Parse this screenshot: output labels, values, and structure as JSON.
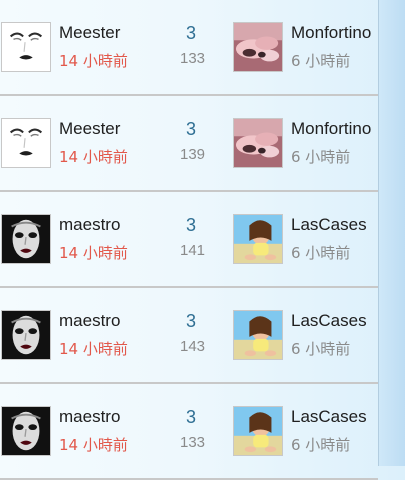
{
  "colors": {
    "background": "#eef8fd",
    "accent": "#2f6f93",
    "time_highlight": "#e2584b",
    "muted": "#8a8a8a",
    "divider": "#c8c8c8"
  },
  "rows": [
    {
      "left_user": "Meester",
      "left_time": "14 小時前",
      "score": "3",
      "sub_score": "133",
      "right_user": "Monfortino",
      "right_time": "6 小時前",
      "left_avatar": "mask-portrait-icon",
      "right_avatar": "pink-photo-icon"
    },
    {
      "left_user": "Meester",
      "left_time": "14 小時前",
      "score": "3",
      "sub_score": "139",
      "right_user": "Monfortino",
      "right_time": "6 小時前",
      "left_avatar": "mask-portrait-icon",
      "right_avatar": "pink-photo-icon"
    },
    {
      "left_user": "maestro",
      "left_time": "14 小時前",
      "score": "3",
      "sub_score": "141",
      "right_user": "LasCases",
      "right_time": "6 小時前",
      "left_avatar": "bw-portrait-icon",
      "right_avatar": "beach-photo-icon"
    },
    {
      "left_user": "maestro",
      "left_time": "14 小時前",
      "score": "3",
      "sub_score": "143",
      "right_user": "LasCases",
      "right_time": "6 小時前",
      "left_avatar": "bw-portrait-icon",
      "right_avatar": "beach-photo-icon"
    },
    {
      "left_user": "maestro",
      "left_time": "14 小時前",
      "score": "3",
      "sub_score": "133",
      "right_user": "LasCases",
      "right_time": "6 小時前",
      "left_avatar": "bw-portrait-icon",
      "right_avatar": "beach-photo-icon"
    }
  ]
}
